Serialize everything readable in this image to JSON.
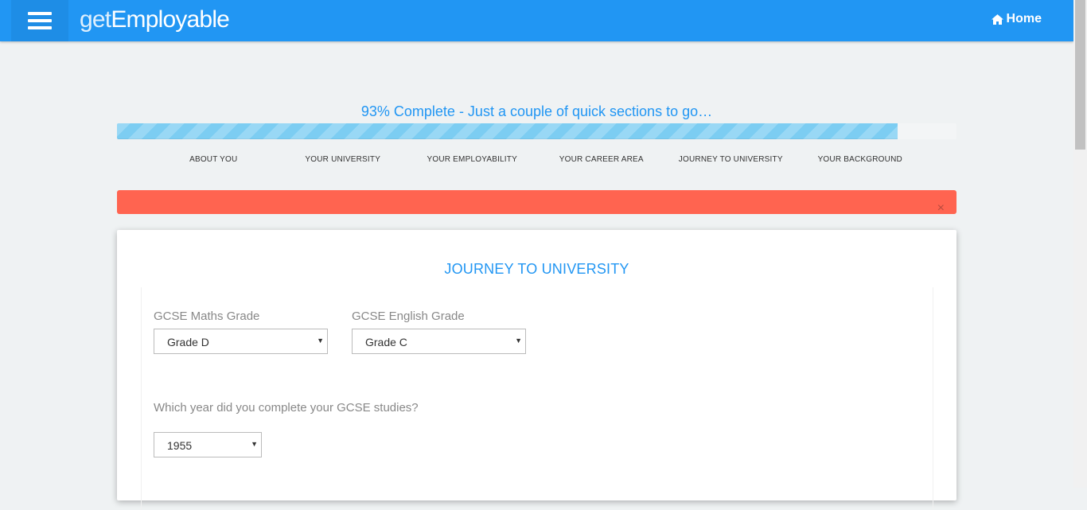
{
  "navbar": {
    "logo_light": "get",
    "logo_bold": "Employable",
    "home_label": "Home"
  },
  "progress": {
    "title": "93% Complete - Just a couple of quick sections to go…",
    "percent": 93,
    "steps": [
      "About You",
      "Your University",
      "Your Employability",
      "Your Career Area",
      "Journey to University",
      "Your Background"
    ]
  },
  "alert": {
    "close_symbol": "×"
  },
  "form": {
    "title": "JOURNEY TO UNIVERSITY",
    "maths_label": "GCSE Maths Grade",
    "maths_value": "Grade D",
    "english_label": "GCSE English Grade",
    "english_value": "Grade C",
    "year_label": "Which year did you complete your GCSE studies?",
    "year_value": "1955"
  },
  "colors": {
    "brand": "#2196f3",
    "alert": "#ff6450",
    "progress_fill": "#7ccdf2"
  },
  "icons": {
    "menu": "hamburger-icon",
    "home": "home-icon",
    "select_arrow": "caret-down-icon"
  }
}
